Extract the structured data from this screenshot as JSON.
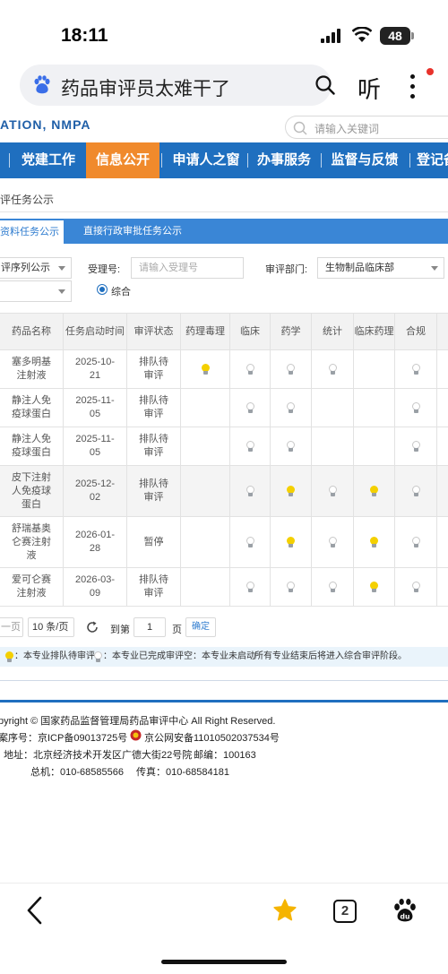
{
  "status": {
    "time": "18:11",
    "battery": "48"
  },
  "browser": {
    "query": "药品审评员太难干了",
    "listen": "听",
    "tab_count": "2"
  },
  "site": {
    "brand": "ATION, NMPA",
    "search_placeholder": "请输入关键词"
  },
  "nav": [
    "党建工作",
    "信息公开",
    "申请人之窗",
    "办事服务",
    "监督与反馈",
    "登记备"
  ],
  "breadcrumb": "评任务公示",
  "tabs": [
    "资料任务公示",
    "直接行政审批任务公示"
  ],
  "filters": {
    "seq_select": "评序列公示",
    "receipt_label": "受理号:",
    "receipt_placeholder": "请输入受理号",
    "dept_label": "审评部门:",
    "dept_value": "生物制品临床部",
    "radio_label": "综合"
  },
  "table": {
    "headers": [
      "药品名称",
      "任务启动时间",
      "审评状态",
      "药理毒理",
      "临床",
      "药学",
      "统计",
      "临床药理",
      "合规"
    ],
    "rows": [
      {
        "name": "塞多明基注射液",
        "date": "2025-10-21",
        "status": "排队待审评",
        "lights": [
          "on",
          "off",
          "off",
          "off",
          "",
          "off"
        ]
      },
      {
        "name": "静注人免疫球蛋白",
        "date": "2025-11-05",
        "status": "排队待审评",
        "lights": [
          "",
          "off",
          "off",
          "",
          "",
          "off"
        ]
      },
      {
        "name": "静注人免疫球蛋白",
        "date": "2025-11-05",
        "status": "排队待审评",
        "lights": [
          "",
          "off",
          "off",
          "",
          "",
          "off"
        ]
      },
      {
        "name": "皮下注射人免疫球蛋白",
        "date": "2025-12-02",
        "status": "排队待审评",
        "lights": [
          "",
          "off",
          "on",
          "off",
          "on",
          "off"
        ]
      },
      {
        "name": "舒瑞基奥仑赛注射液",
        "date": "2026-01-28",
        "status": "暂停",
        "lights": [
          "",
          "off",
          "on",
          "off",
          "on",
          "off"
        ]
      },
      {
        "name": "爱可仑赛注射液",
        "date": "2026-03-09",
        "status": "排队待审评",
        "lights": [
          "",
          "off",
          "off",
          "off",
          "on",
          "off"
        ]
      }
    ]
  },
  "pagination": {
    "prev": "一页",
    "page_size": "10 条/页",
    "goto_label": "到第",
    "page_value": "1",
    "page_unit": "页",
    "confirm": "确定"
  },
  "legend": {
    "pending": "：本专业排队待审评",
    "done": "：本专业已完成审评",
    "empty": "空：本专业未启动",
    "note": "所有专业结束后将进入综合审评阶段。"
  },
  "footer": {
    "copyright": "pyright © 国家药品监督管理局药品审评中心   All Right Reserved.",
    "icp": "案序号：京ICP备09013725号",
    "police": "京公网安备11010502037534号",
    "address": "地址：北京经济技术开发区广德大街22号院",
    "postcode": "邮编：100163",
    "phone": "总机：010-68585566",
    "fax": "传真：010-68584181"
  }
}
